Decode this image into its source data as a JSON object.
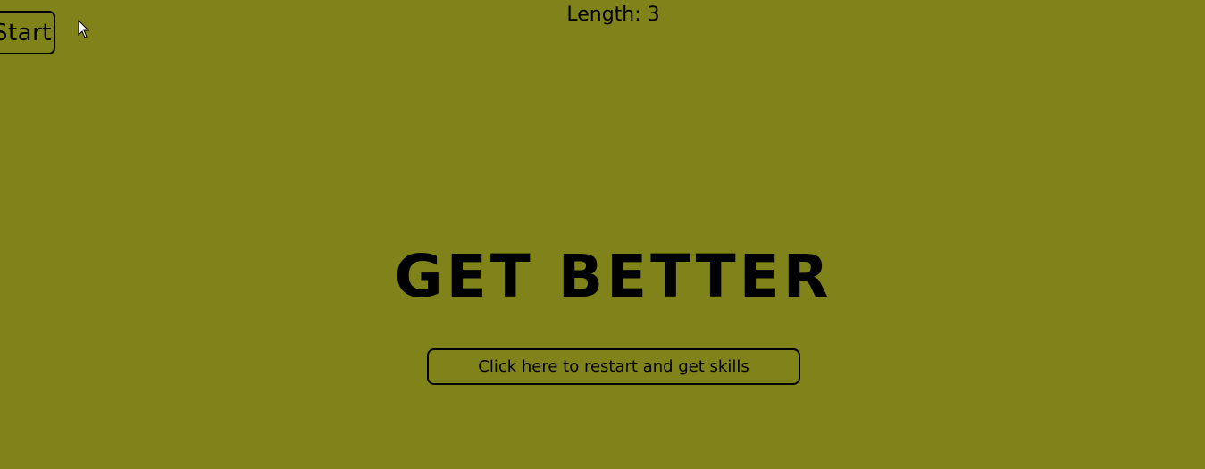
{
  "hud": {
    "start_label": "Start",
    "length_text": "Length: 3"
  },
  "game_over": {
    "title": "GET BETTER",
    "restart_label": "Click here to restart and get skills"
  },
  "colors": {
    "background": "#80821a",
    "foreground": "#000000"
  },
  "icons": {
    "cursor": "mouse-pointer-icon"
  }
}
